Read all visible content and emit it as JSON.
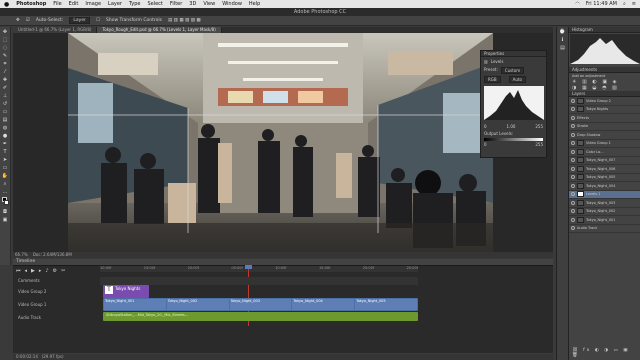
{
  "menubar": {
    "apple": "",
    "app": "Photoshop",
    "items": [
      "File",
      "Edit",
      "Image",
      "Layer",
      "Type",
      "Select",
      "Filter",
      "3D",
      "View",
      "Window",
      "Help"
    ],
    "right_time": "Fri 11:49 AM"
  },
  "app_title": "Adobe Photoshop CC",
  "options": {
    "auto_select_label": "Auto-Select:",
    "auto_select_value": "Layer",
    "show_transform": "Show Transform Controls"
  },
  "doc_tabs": [
    "Untitled-1 @ 66.7% (Layer 1, RGB/8)",
    "Tokyo_Rough_Edit.psd @ 66.7% (Levels 1, Layer Mask/8)"
  ],
  "status": {
    "zoom": "66.7%",
    "doc_size": "Doc: 2.64M/136.8M"
  },
  "timeline": {
    "title": "Timeline",
    "ruler": [
      "10:00f",
      "15:00f",
      "20:00f",
      "05:00f",
      "10:00f",
      "15:00f",
      "20:00f",
      "25:00f"
    ],
    "tracks": [
      {
        "label": "Comments"
      },
      {
        "label": "Video Group 2"
      },
      {
        "label": "Video Group 1"
      },
      {
        "label": "Audio Track"
      }
    ],
    "clips": {
      "title_clip": "Tokyo Nights",
      "video_clips": [
        "Tokyo_Night_001",
        "Tokyo_Night_002",
        "Tokyo_Night_003",
        "Tokyo_Night_004",
        "Tokyo_Night_005"
      ],
      "audio_clip": "ShibuyaStation_...Mid_Tokyo_20._Mix_Streets..."
    },
    "timecode": "0:00:02:14",
    "fps": "(29.97 fps)"
  },
  "properties": {
    "title": "Properties",
    "panel_label": "Levels",
    "preset_label": "Preset:",
    "preset_value": "Custom",
    "channel": "RGB",
    "auto": "Auto",
    "in_low": "0",
    "in_mid": "1.00",
    "in_high": "255",
    "out_label": "Output Levels:",
    "out_low": "0",
    "out_high": "255"
  },
  "right_panels": {
    "histogram_title": "Histogram",
    "adjustments_title": "Adjustments",
    "add_adjustment": "Add an adjustment",
    "layers_title": "Layers",
    "layers": [
      {
        "name": "Video Group 2"
      },
      {
        "name": "Tokyo Nights"
      },
      {
        "name": "Effects"
      },
      {
        "name": "Stroke"
      },
      {
        "name": "Drop Shadow"
      },
      {
        "name": "Video Group 1"
      },
      {
        "name": "Color Lo..."
      },
      {
        "name": "Tokyo_Night_007"
      },
      {
        "name": "Tokyo_Night_006"
      },
      {
        "name": "Tokyo_Night_005"
      },
      {
        "name": "Tokyo_Night_004"
      },
      {
        "name": "Levels 1"
      },
      {
        "name": "Tokyo_Night_003"
      },
      {
        "name": "Tokyo_Night_002"
      },
      {
        "name": "Tokyo_Night_001"
      },
      {
        "name": "Audio Track"
      }
    ]
  },
  "colors": {
    "title_clip": "#7c4bb0",
    "video_clip": "#4d6fa6",
    "audio_clip": "#6d9a2e",
    "selected_layer": "#5b6f8f"
  }
}
